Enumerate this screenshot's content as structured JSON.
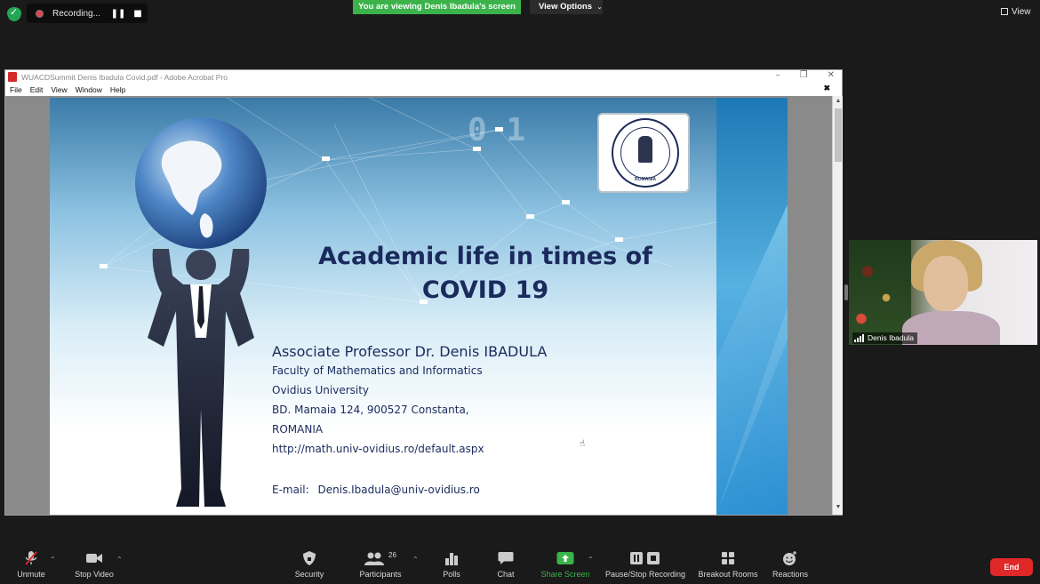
{
  "top": {
    "recording_label": "Recording...",
    "viewing_banner": "You are viewing Denis Ibadula's screen",
    "view_options": "View Options",
    "view_label": "View"
  },
  "acrobat": {
    "title": "WUACDSummit Denis Ibadula Covid.pdf - Adobe Acrobat Pro",
    "menu": [
      "File",
      "Edit",
      "View",
      "Window",
      "Help"
    ]
  },
  "slide": {
    "title_line1": "Academic life in times of",
    "title_line2": "COVID 19",
    "author": "Associate Professor Dr. Denis IBADULA",
    "lines": [
      "Faculty of Mathematics and Informatics",
      "Ovidius University",
      "BD. Mamaia 124, 900527 Constanta,",
      "ROMANIA",
      "http://math.univ-ovidius.ro/default.aspx"
    ],
    "email_label": "E-mail:",
    "email": "Denis.Ibadula@univ-ovidius.ro",
    "seal_text": "ROMANIA"
  },
  "video": {
    "participant_name": "Denis Ibadula"
  },
  "toolbar": {
    "unmute": "Unmute",
    "stop_video": "Stop Video",
    "security": "Security",
    "participants": "Participants",
    "participant_count": "26",
    "polls": "Polls",
    "chat": "Chat",
    "share_screen": "Share Screen",
    "pause_recording": "Pause/Stop Recording",
    "breakout_rooms": "Breakout Rooms",
    "reactions": "Reactions",
    "end": "End"
  },
  "colors": {
    "share_green": "#3bb34a",
    "end_red": "#e02828",
    "slide_text": "#1a2a5c"
  }
}
